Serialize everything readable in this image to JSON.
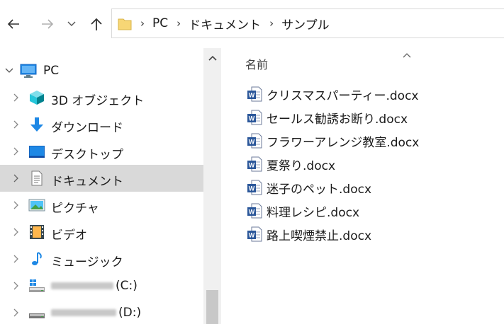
{
  "navigation": {
    "back_icon": "arrow-left-icon",
    "forward_icon": "arrow-right-icon",
    "recent_icon": "chevron-down-icon",
    "up_icon": "arrow-up-icon"
  },
  "address_bar": {
    "folder_icon": "folder-icon",
    "crumbs": [
      "PC",
      "ドキュメント",
      "サンプル"
    ]
  },
  "sidebar": {
    "items": [
      {
        "label": "PC",
        "icon": "computer-icon"
      },
      {
        "label": "3D オブジェクト",
        "icon": "3d-objects-icon"
      },
      {
        "label": "ダウンロード",
        "icon": "download-icon"
      },
      {
        "label": "デスクトップ",
        "icon": "desktop-icon"
      },
      {
        "label": "ドキュメント",
        "icon": "documents-icon",
        "selected": true
      },
      {
        "label": "ピクチャ",
        "icon": "pictures-icon"
      },
      {
        "label": "ビデオ",
        "icon": "videos-icon"
      },
      {
        "label": "ミュージック",
        "icon": "music-icon"
      },
      {
        "label": "(C:)",
        "icon": "drive-icon"
      },
      {
        "label": "(D:)",
        "icon": "drive-icon"
      }
    ]
  },
  "main": {
    "column_header": "名前",
    "files": [
      "クリスマスパーティー.docx",
      "セールス勧誘お断り.docx",
      "フラワーアレンジ教室.docx",
      "夏祭り.docx",
      "迷子のペット.docx",
      "料理レシピ.docx",
      "路上喫煙禁止.docx"
    ]
  },
  "colors": {
    "selected_bg": "#d9d9d9",
    "word_blue": "#2b579a",
    "folder_yellow": "#f7d675",
    "icon_blue": "#1e88e5"
  }
}
